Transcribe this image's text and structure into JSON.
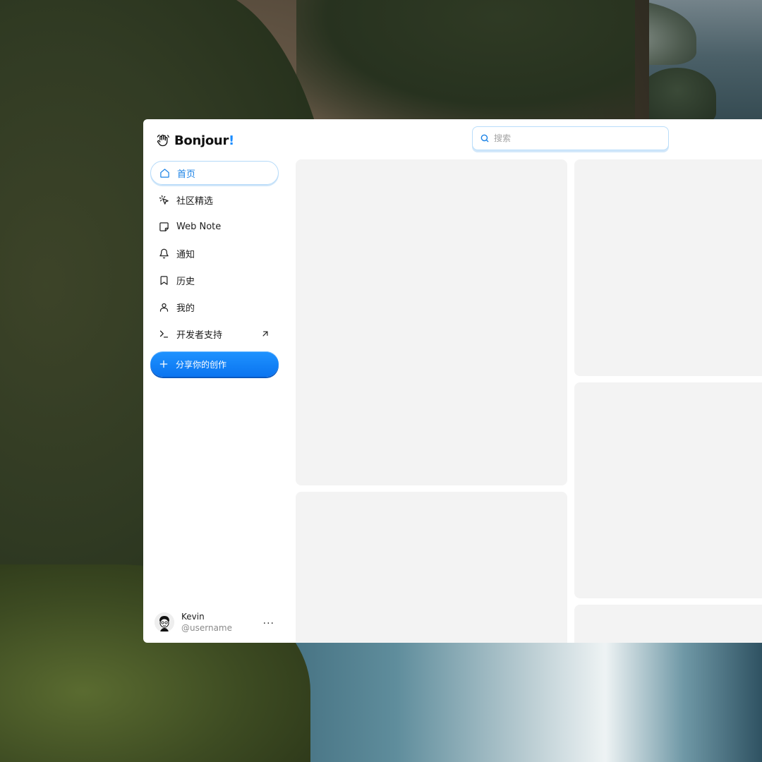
{
  "app": {
    "logo_text": "Bonjour",
    "logo_accent": "!",
    "accent_color": "#1a8cff"
  },
  "search": {
    "placeholder": "搜索",
    "value": ""
  },
  "sidebar": {
    "items": [
      {
        "label": "首页",
        "icon": "home-icon",
        "active": true
      },
      {
        "label": "社区精选",
        "icon": "cursor-click-icon",
        "active": false
      },
      {
        "label": "Web Note",
        "icon": "note-icon",
        "active": false
      },
      {
        "label": "通知",
        "icon": "bell-icon",
        "active": false
      },
      {
        "label": "历史",
        "icon": "bookmark-icon",
        "active": false
      },
      {
        "label": "我的",
        "icon": "user-icon",
        "active": false
      },
      {
        "label": "开发者支持",
        "icon": "terminal-icon",
        "active": false,
        "external": true
      }
    ],
    "share_button": {
      "label": "分享你的创作",
      "icon": "plus-icon"
    }
  },
  "user": {
    "name": "Kevin",
    "handle": "@username",
    "more_label": "..."
  },
  "feed": {
    "placeholder_cards": 5
  }
}
